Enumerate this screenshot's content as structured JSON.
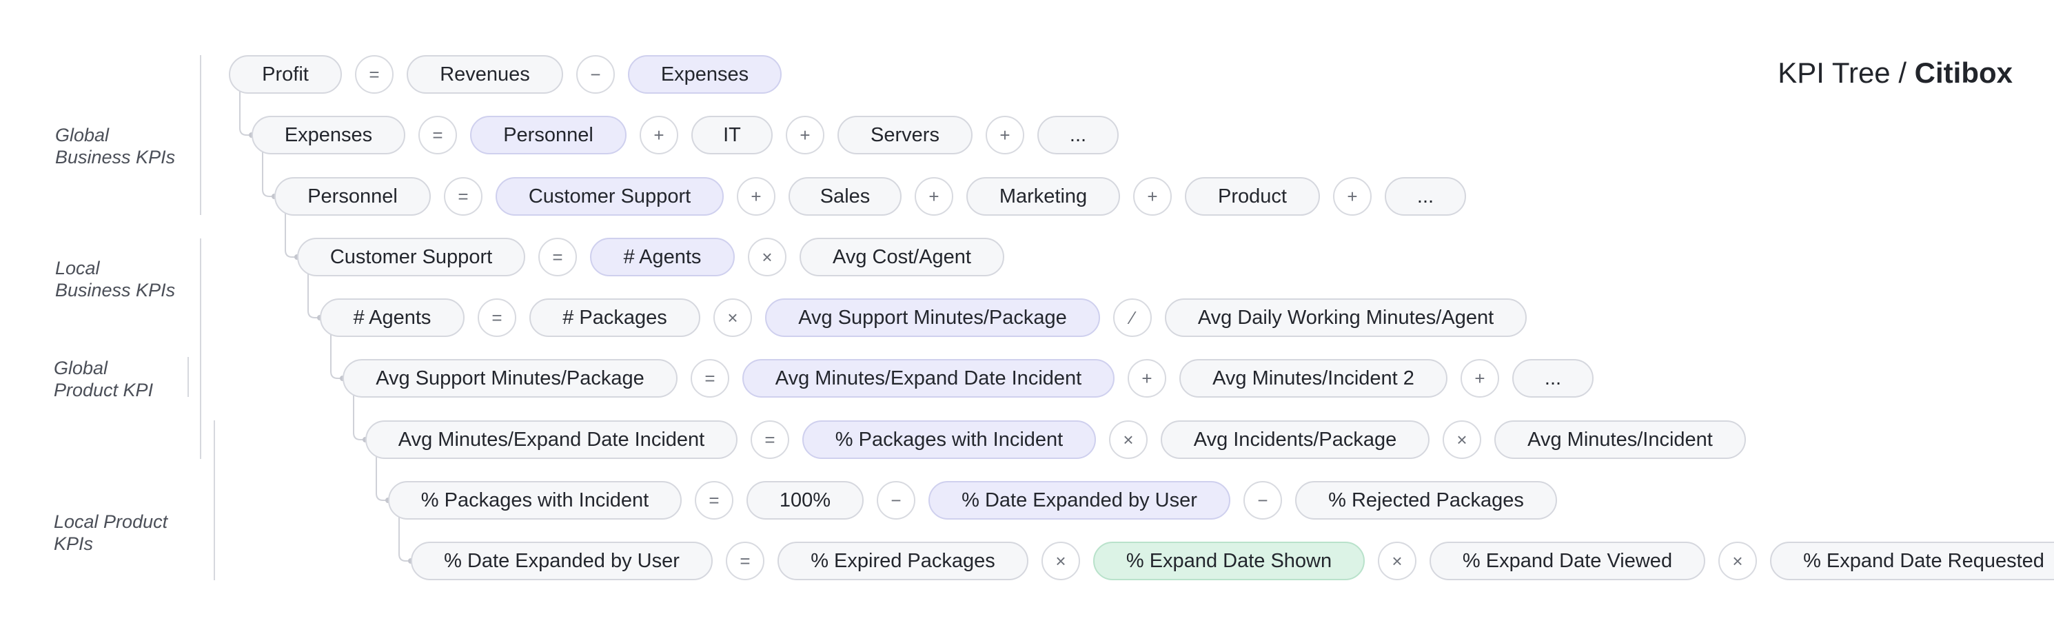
{
  "title": {
    "prefix": "KPI Tree / ",
    "brand": "Citibox"
  },
  "categories": [
    {
      "label": "Global\nBusiness KPIs"
    },
    {
      "label": "Local\nBusiness KPIs"
    },
    {
      "label": "Global\nProduct KPI"
    },
    {
      "label": "Local Product\nKPIs"
    }
  ],
  "rows": [
    {
      "items": [
        {
          "kind": "node",
          "text": "Profit"
        },
        {
          "kind": "op",
          "text": "="
        },
        {
          "kind": "node",
          "text": "Revenues"
        },
        {
          "kind": "op",
          "text": "−"
        },
        {
          "kind": "node",
          "text": "Expenses",
          "style": "hl"
        }
      ]
    },
    {
      "items": [
        {
          "kind": "node",
          "text": "Expenses"
        },
        {
          "kind": "op",
          "text": "="
        },
        {
          "kind": "node",
          "text": "Personnel",
          "style": "hl"
        },
        {
          "kind": "op",
          "text": "+"
        },
        {
          "kind": "node",
          "text": "IT"
        },
        {
          "kind": "op",
          "text": "+"
        },
        {
          "kind": "node",
          "text": "Servers"
        },
        {
          "kind": "op",
          "text": "+"
        },
        {
          "kind": "node",
          "text": "..."
        }
      ]
    },
    {
      "items": [
        {
          "kind": "node",
          "text": "Personnel"
        },
        {
          "kind": "op",
          "text": "="
        },
        {
          "kind": "node",
          "text": "Customer Support",
          "style": "hl"
        },
        {
          "kind": "op",
          "text": "+"
        },
        {
          "kind": "node",
          "text": "Sales"
        },
        {
          "kind": "op",
          "text": "+"
        },
        {
          "kind": "node",
          "text": "Marketing"
        },
        {
          "kind": "op",
          "text": "+"
        },
        {
          "kind": "node",
          "text": "Product"
        },
        {
          "kind": "op",
          "text": "+"
        },
        {
          "kind": "node",
          "text": "..."
        }
      ]
    },
    {
      "items": [
        {
          "kind": "node",
          "text": "Customer Support"
        },
        {
          "kind": "op",
          "text": "="
        },
        {
          "kind": "node",
          "text": "# Agents",
          "style": "hl"
        },
        {
          "kind": "op",
          "text": "×"
        },
        {
          "kind": "node",
          "text": "Avg Cost/Agent"
        }
      ]
    },
    {
      "items": [
        {
          "kind": "node",
          "text": "# Agents"
        },
        {
          "kind": "op",
          "text": "="
        },
        {
          "kind": "node",
          "text": "# Packages"
        },
        {
          "kind": "op",
          "text": "×"
        },
        {
          "kind": "node",
          "text": "Avg Support Minutes/Package",
          "style": "hl"
        },
        {
          "kind": "op",
          "text": "⁄"
        },
        {
          "kind": "node",
          "text": "Avg Daily Working Minutes/Agent"
        }
      ]
    },
    {
      "items": [
        {
          "kind": "node",
          "text": "Avg Support Minutes/Package"
        },
        {
          "kind": "op",
          "text": "="
        },
        {
          "kind": "node",
          "text": "Avg Minutes/Expand Date Incident",
          "style": "hl"
        },
        {
          "kind": "op",
          "text": "+"
        },
        {
          "kind": "node",
          "text": "Avg Minutes/Incident 2"
        },
        {
          "kind": "op",
          "text": "+"
        },
        {
          "kind": "node",
          "text": "..."
        }
      ]
    },
    {
      "items": [
        {
          "kind": "node",
          "text": "Avg Minutes/Expand Date Incident"
        },
        {
          "kind": "op",
          "text": "="
        },
        {
          "kind": "node",
          "text": "% Packages with Incident",
          "style": "hl"
        },
        {
          "kind": "op",
          "text": "×"
        },
        {
          "kind": "node",
          "text": "Avg Incidents/Package"
        },
        {
          "kind": "op",
          "text": "×"
        },
        {
          "kind": "node",
          "text": "Avg Minutes/Incident"
        }
      ]
    },
    {
      "items": [
        {
          "kind": "node",
          "text": "% Packages with Incident"
        },
        {
          "kind": "op",
          "text": "="
        },
        {
          "kind": "node",
          "text": "100%"
        },
        {
          "kind": "op",
          "text": "−"
        },
        {
          "kind": "node",
          "text": "% Date Expanded by User",
          "style": "hl"
        },
        {
          "kind": "op",
          "text": "−"
        },
        {
          "kind": "node",
          "text": "% Rejected Packages"
        }
      ]
    },
    {
      "items": [
        {
          "kind": "node",
          "text": "% Date Expanded by User"
        },
        {
          "kind": "op",
          "text": "="
        },
        {
          "kind": "node",
          "text": "% Expired Packages"
        },
        {
          "kind": "op",
          "text": "×"
        },
        {
          "kind": "node",
          "text": "% Expand Date Shown",
          "style": "green"
        },
        {
          "kind": "op",
          "text": "×"
        },
        {
          "kind": "node",
          "text": "% Expand Date Viewed"
        },
        {
          "kind": "op",
          "text": "×"
        },
        {
          "kind": "node",
          "text": "% Expand Date Requested"
        }
      ]
    }
  ]
}
